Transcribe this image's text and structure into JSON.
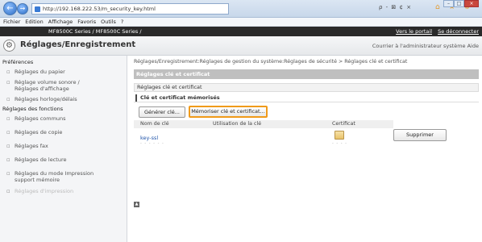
{
  "browser": {
    "url": "http://192.168.222.53/m_security_key.html",
    "addr_tools": "ρ - ⊠ ¢ ×",
    "menu": [
      "Fichier",
      "Edition",
      "Affichage",
      "Favoris",
      "Outils",
      "?"
    ]
  },
  "device": {
    "name": "MF8500C Series / MF8500C Series /",
    "portal_link": "Vers le portail",
    "logout_link": "Se déconnecter"
  },
  "header": {
    "title": "Réglages/Enregistrement",
    "right_text": "Courrier à l'administrateur système  Aide"
  },
  "sidebar": {
    "section1": "Préférences",
    "items1": [
      "Réglages du papier",
      "Réglage volume sonore / Réglages d'affichage",
      "Réglages horloge/délais"
    ],
    "section2": "Réglages des fonctions",
    "items2": [
      "Réglages communs",
      "Réglages de copie",
      "Réglages fax",
      "Réglages de lecture",
      "Réglages du mode Impression support mémoire",
      "Réglages d'impression"
    ]
  },
  "main": {
    "breadcrumb": "Réglages/Enregistrement:Réglages de gestion du système:Réglages de sécurité > Réglages clé et certificat",
    "page_title": "Réglages clé et certificat",
    "section_title": "Réglages clé et certificat",
    "subsection_title": "Clé et certificat mémorisés",
    "btn_generate": "Générer clé...",
    "btn_register": "Mémoriser clé et certificat...",
    "col_key": "Nom de clé",
    "col_use": "Utilisation de la clé",
    "col_cert": "Certificat",
    "row_key": "key-ssl",
    "btn_delete": "Supprimer"
  }
}
